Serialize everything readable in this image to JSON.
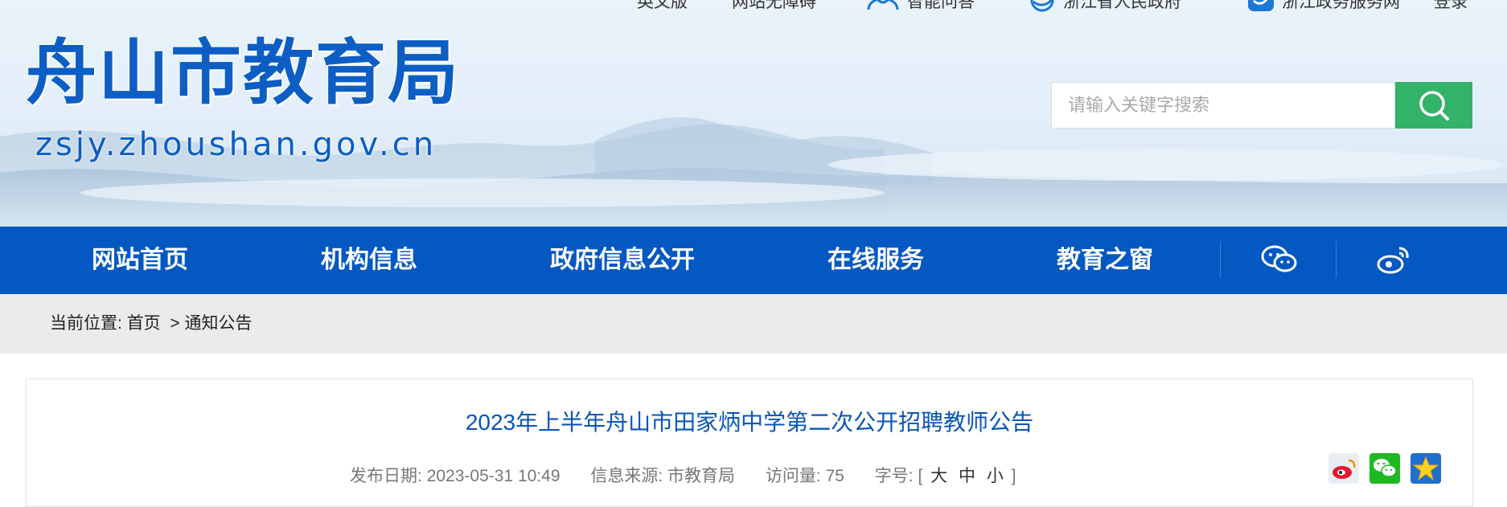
{
  "toplinks": {
    "english": "英文版",
    "accessible": "网站无障碍",
    "qa": "智能问答",
    "zj_gov": "浙江省人民政府",
    "zj_service": "浙江政务服务网",
    "login": "登录"
  },
  "logo": {
    "name": "舟山市教育局",
    "url": "zsjy.zhoushan.gov.cn"
  },
  "search": {
    "placeholder": "请输入关键字搜索"
  },
  "nav": {
    "items": [
      "网站首页",
      "机构信息",
      "政府信息公开",
      "在线服务",
      "教育之窗"
    ],
    "icons": [
      "wechat-icon",
      "weibo-icon"
    ]
  },
  "breadcrumb": {
    "label": "当前位置:",
    "home": "首页",
    "separator": ">",
    "current": "通知公告"
  },
  "article": {
    "title": "2023年上半年舟山市田家炳中学第二次公开招聘教师公告",
    "publish_label": "发布日期:",
    "publish_date": "2023-05-31 10:49",
    "source_label": "信息来源:",
    "source": "市教育局",
    "views_label": "访问量:",
    "views": "75",
    "fontsize_label": "字号:",
    "fontsize_open": "[",
    "fontsize_large": "大",
    "fontsize_medium": "中",
    "fontsize_small": "小",
    "fontsize_close": "]",
    "share_icons": [
      "weibo-share-icon",
      "wechat-share-icon",
      "favorite-star-icon"
    ]
  },
  "colors": {
    "nav_bg": "#0458c1",
    "brand_blue": "#0d5ec4",
    "search_button": "#33b26a",
    "title_blue": "#0b55b8",
    "breadcrumb_bg": "#ebebeb"
  }
}
